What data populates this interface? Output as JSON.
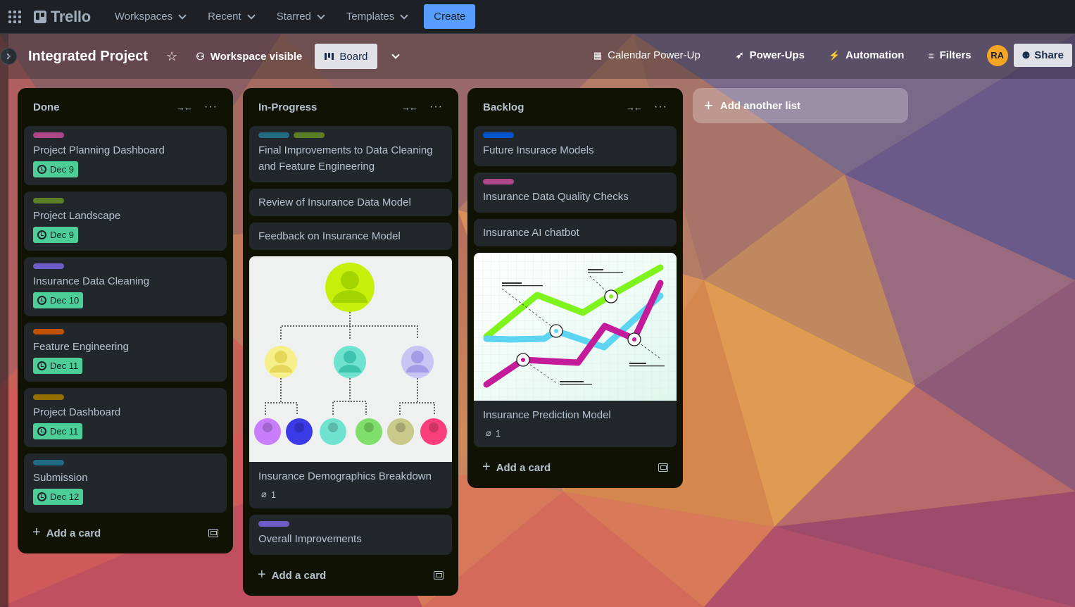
{
  "nav": {
    "logo": "Trello",
    "items": [
      {
        "label": "Workspaces"
      },
      {
        "label": "Recent"
      },
      {
        "label": "Starred"
      },
      {
        "label": "Templates"
      }
    ],
    "create": "Create"
  },
  "header": {
    "title": "Integrated Project",
    "visibility": "Workspace visible",
    "view": "Board",
    "calendar": "Calendar Power-Up",
    "powerups": "Power-Ups",
    "automation": "Automation",
    "filters": "Filters",
    "avatar": "RA",
    "share": "Share"
  },
  "lists": [
    {
      "title": "Done",
      "add_card": "Add a card",
      "cards": [
        {
          "title": "Project Planning Dashboard",
          "label_colors": [
            "#ae4787"
          ],
          "due": "Dec 9"
        },
        {
          "title": "Project Landscape",
          "label_colors": [
            "#5b7f24"
          ],
          "due": "Dec 9"
        },
        {
          "title": "Insurance Data Cleaning",
          "label_colors": [
            "#6e5dc6"
          ],
          "due": "Dec 10"
        },
        {
          "title": "Feature Engineering",
          "label_colors": [
            "#c25100"
          ],
          "due": "Dec 11"
        },
        {
          "title": "Project Dashboard",
          "label_colors": [
            "#946f00"
          ],
          "due": "Dec 11"
        },
        {
          "title": "Submission",
          "label_colors": [
            "#206a83"
          ],
          "due": "Dec 12"
        }
      ]
    },
    {
      "title": "In-Progress",
      "add_card": "Add a card",
      "cards": [
        {
          "title": "Final Improvements to Data Cleaning and Feature Engineering",
          "label_colors": [
            "#206a83",
            "#5b7f24"
          ]
        },
        {
          "title": "Review of Insurance Data Model"
        },
        {
          "title": "Feedback on Insurance Model"
        },
        {
          "title": "Insurance Demographics Breakdown",
          "attachments": "1"
        },
        {
          "title": "Overall Improvements",
          "label_colors": [
            "#6e5dc6"
          ]
        }
      ]
    },
    {
      "title": "Backlog",
      "add_card": "Add a card",
      "cards": [
        {
          "title": "Future Insurace Models",
          "label_colors": [
            "#0055cc"
          ]
        },
        {
          "title": "Insurance Data Quality Checks",
          "label_colors": [
            "#ae4787"
          ]
        },
        {
          "title": "Insurance AI chatbot"
        },
        {
          "title": "Insurance Prediction Model",
          "attachments": "1"
        }
      ]
    }
  ],
  "add_list": "Add another list",
  "colors": {
    "due_badge": "#4bce97",
    "list_bg": "#101204",
    "card_bg": "#22272b",
    "create_btn": "#579dff",
    "avatar": "#f5a524"
  }
}
